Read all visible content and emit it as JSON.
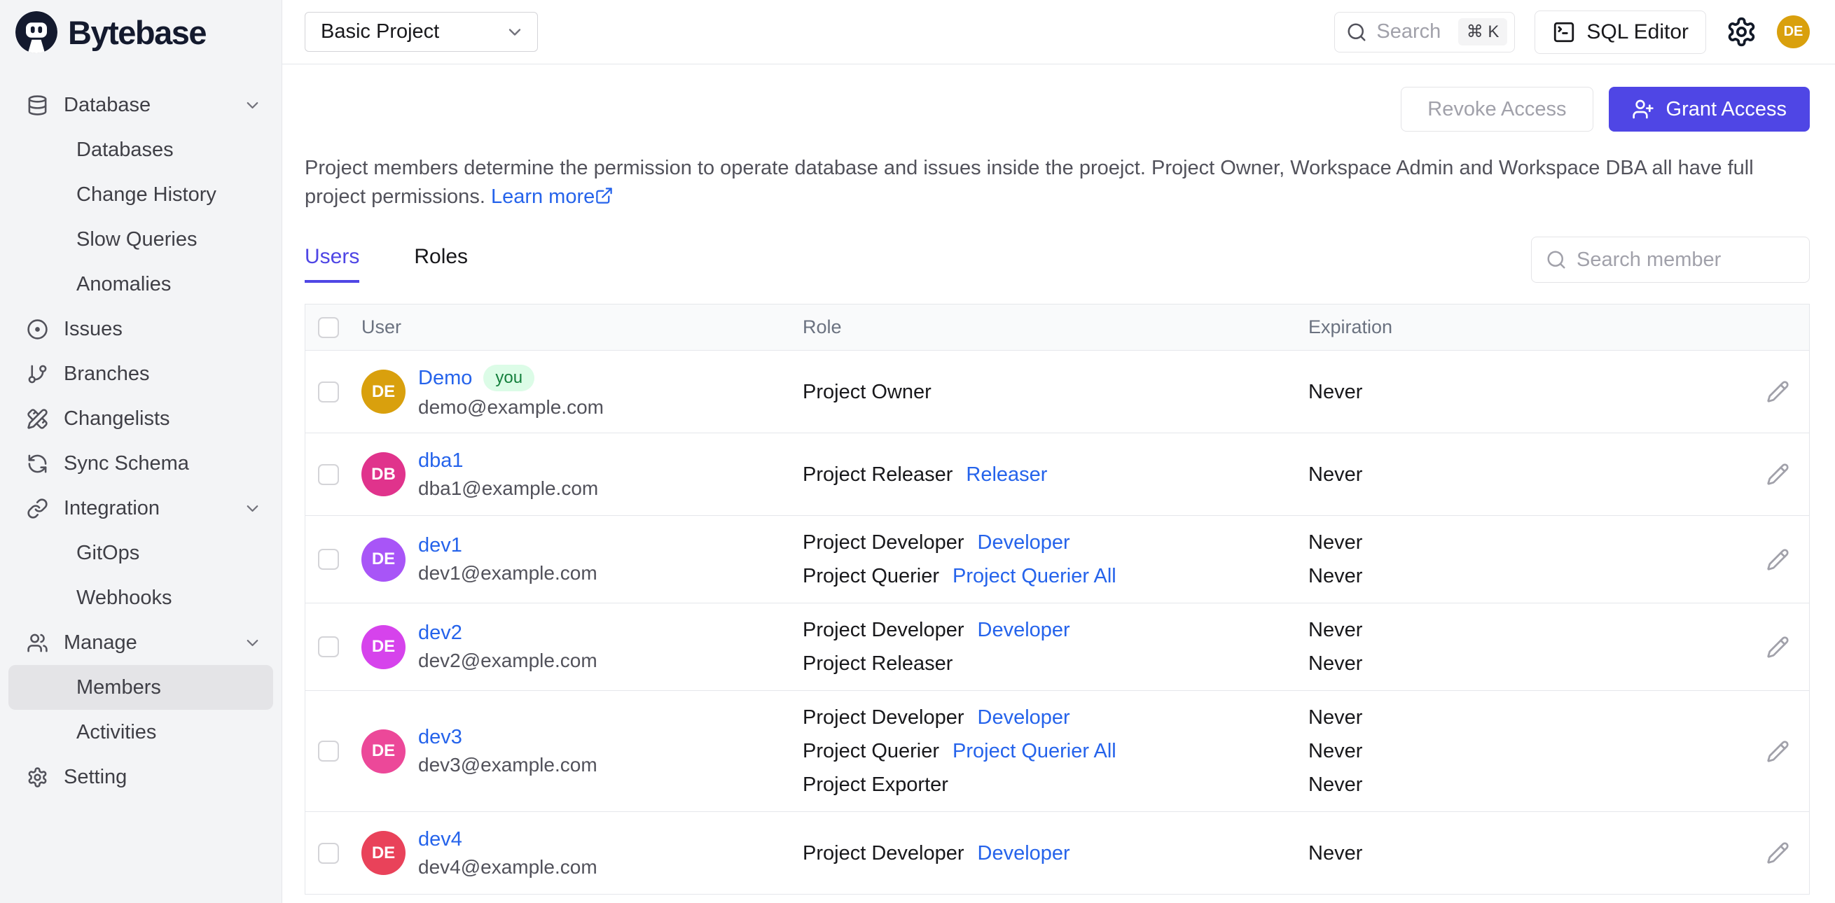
{
  "brand": {
    "logo_icon": "bytebase-robot-logo",
    "wordmark": "Bytebase"
  },
  "topbar": {
    "project_selector": {
      "value": "Basic Project",
      "chevron_icon": "chevron-down"
    },
    "search": {
      "icon": "search",
      "placeholder": "Search",
      "shortcut": "⌘ K"
    },
    "sql_editor": {
      "icon": "square-terminal",
      "label": "SQL Editor"
    },
    "settings_icon": "settings-gear",
    "avatar": {
      "initials": "DE",
      "color": "#D9A00D"
    }
  },
  "sidebar": {
    "items": [
      {
        "id": "database",
        "label": "Database",
        "icon": "database",
        "chevron": true,
        "level": 0,
        "active": false
      },
      {
        "id": "databases",
        "label": "Databases",
        "icon": null,
        "chevron": false,
        "level": 1,
        "active": false
      },
      {
        "id": "change-history",
        "label": "Change History",
        "icon": null,
        "chevron": false,
        "level": 1,
        "active": false
      },
      {
        "id": "slow-queries",
        "label": "Slow Queries",
        "icon": null,
        "chevron": false,
        "level": 1,
        "active": false
      },
      {
        "id": "anomalies",
        "label": "Anomalies",
        "icon": null,
        "chevron": false,
        "level": 1,
        "active": false
      },
      {
        "id": "issues",
        "label": "Issues",
        "icon": "circle-dot",
        "chevron": false,
        "level": 0,
        "active": false
      },
      {
        "id": "branches",
        "label": "Branches",
        "icon": "git-branch",
        "chevron": false,
        "level": 0,
        "active": false
      },
      {
        "id": "changelists",
        "label": "Changelists",
        "icon": "pencil-ruler",
        "chevron": false,
        "level": 0,
        "active": false
      },
      {
        "id": "sync-schema",
        "label": "Sync Schema",
        "icon": "refresh",
        "chevron": false,
        "level": 0,
        "active": false
      },
      {
        "id": "integration",
        "label": "Integration",
        "icon": "link",
        "chevron": true,
        "level": 0,
        "active": false
      },
      {
        "id": "gitops",
        "label": "GitOps",
        "icon": null,
        "chevron": false,
        "level": 1,
        "active": false
      },
      {
        "id": "webhooks",
        "label": "Webhooks",
        "icon": null,
        "chevron": false,
        "level": 1,
        "active": false
      },
      {
        "id": "manage",
        "label": "Manage",
        "icon": "users",
        "chevron": true,
        "level": 0,
        "active": false
      },
      {
        "id": "members",
        "label": "Members",
        "icon": null,
        "chevron": false,
        "level": 1,
        "active": true
      },
      {
        "id": "activities",
        "label": "Activities",
        "icon": null,
        "chevron": false,
        "level": 1,
        "active": false
      },
      {
        "id": "setting",
        "label": "Setting",
        "icon": "settings-gear",
        "chevron": false,
        "level": 0,
        "active": false
      }
    ]
  },
  "page": {
    "revoke_button": "Revoke Access",
    "grant_button": {
      "icon": "user-plus",
      "label": "Grant Access",
      "color": "#4F46E5"
    },
    "description": "Project members determine the permission to operate database and issues inside the proejct. Project Owner, Workspace Admin and Workspace DBA all have full project permissions.",
    "learn_more": {
      "label": "Learn more",
      "icon": "external-link"
    },
    "tabs": [
      {
        "label": "Users",
        "active": true
      },
      {
        "label": "Roles",
        "active": false
      }
    ],
    "member_search": {
      "icon": "search",
      "placeholder": "Search member"
    },
    "table": {
      "columns": [
        "User",
        "Role",
        "Expiration"
      ],
      "link_color": "#2563EB",
      "you_badge": {
        "label": "you",
        "bg": "#DCFCE7",
        "color": "#15803D"
      },
      "rows": [
        {
          "initials": "DE",
          "avatar_color": "#D9A00D",
          "name": "Demo",
          "badge": "you",
          "email": "demo@example.com",
          "roles": [
            {
              "name": "Project Owner",
              "link": null,
              "expiration": "Never"
            }
          ]
        },
        {
          "initials": "DB",
          "avatar_color": "#E0338C",
          "name": "dba1",
          "badge": null,
          "email": "dba1@example.com",
          "roles": [
            {
              "name": "Project Releaser",
              "link": "Releaser",
              "expiration": "Never"
            }
          ]
        },
        {
          "initials": "DE",
          "avatar_color": "#A855F7",
          "name": "dev1",
          "badge": null,
          "email": "dev1@example.com",
          "roles": [
            {
              "name": "Project Developer",
              "link": "Developer",
              "expiration": "Never"
            },
            {
              "name": "Project Querier",
              "link": "Project Querier All",
              "expiration": "Never"
            }
          ]
        },
        {
          "initials": "DE",
          "avatar_color": "#D643EC",
          "name": "dev2",
          "badge": null,
          "email": "dev2@example.com",
          "roles": [
            {
              "name": "Project Developer",
              "link": "Developer",
              "expiration": "Never"
            },
            {
              "name": "Project Releaser",
              "link": null,
              "expiration": "Never"
            }
          ]
        },
        {
          "initials": "DE",
          "avatar_color": "#EC4899",
          "name": "dev3",
          "badge": null,
          "email": "dev3@example.com",
          "roles": [
            {
              "name": "Project Developer",
              "link": "Developer",
              "expiration": "Never"
            },
            {
              "name": "Project Querier",
              "link": "Project Querier All",
              "expiration": "Never"
            },
            {
              "name": "Project Exporter",
              "link": null,
              "expiration": "Never"
            }
          ]
        },
        {
          "initials": "DE",
          "avatar_color": "#E9425A",
          "name": "dev4",
          "badge": null,
          "email": "dev4@example.com",
          "roles": [
            {
              "name": "Project Developer",
              "link": "Developer",
              "expiration": "Never"
            }
          ]
        }
      ]
    }
  }
}
